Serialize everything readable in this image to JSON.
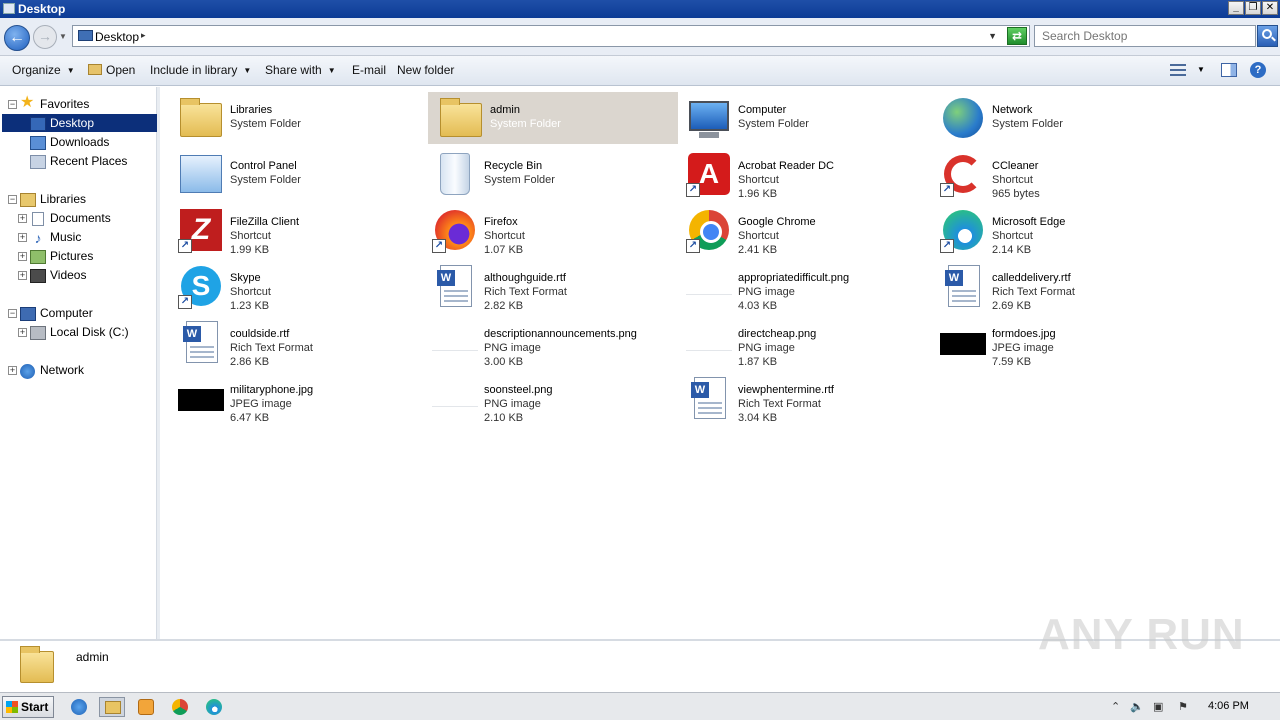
{
  "window": {
    "title": "Desktop"
  },
  "address": {
    "path": "Desktop",
    "search_placeholder": "Search Desktop"
  },
  "toolbar": {
    "organize": "Organize",
    "open": "Open",
    "include": "Include in library",
    "share": "Share with",
    "email": "E-mail",
    "newfolder": "New folder"
  },
  "nav": {
    "favorites": "Favorites",
    "desktop": "Desktop",
    "downloads": "Downloads",
    "recent": "Recent Places",
    "libraries": "Libraries",
    "documents": "Documents",
    "music": "Music",
    "pictures": "Pictures",
    "videos": "Videos",
    "computer": "Computer",
    "localdisk": "Local Disk (C:)",
    "network": "Network"
  },
  "items": [
    {
      "name": "Libraries",
      "type": "System Folder",
      "size": "",
      "icon": "libraries-folder-icon"
    },
    {
      "name": "admin",
      "type": "System Folder",
      "size": "",
      "icon": "user-folder-icon"
    },
    {
      "name": "Computer",
      "type": "System Folder",
      "size": "",
      "icon": "computer-icon"
    },
    {
      "name": "Network",
      "type": "System Folder",
      "size": "",
      "icon": "network-icon"
    },
    {
      "name": "Control Panel",
      "type": "System Folder",
      "size": "",
      "icon": "control-panel-icon"
    },
    {
      "name": "Recycle Bin",
      "type": "System Folder",
      "size": "",
      "icon": "recycle-bin-icon"
    },
    {
      "name": "Acrobat Reader DC",
      "type": "Shortcut",
      "size": "1.96 KB",
      "icon": "acrobat-icon"
    },
    {
      "name": "CCleaner",
      "type": "Shortcut",
      "size": "965 bytes",
      "icon": "ccleaner-icon"
    },
    {
      "name": "FileZilla Client",
      "type": "Shortcut",
      "size": "1.99 KB",
      "icon": "filezilla-icon"
    },
    {
      "name": "Firefox",
      "type": "Shortcut",
      "size": "1.07 KB",
      "icon": "firefox-icon"
    },
    {
      "name": "Google Chrome",
      "type": "Shortcut",
      "size": "2.41 KB",
      "icon": "chrome-icon"
    },
    {
      "name": "Microsoft Edge",
      "type": "Shortcut",
      "size": "2.14 KB",
      "icon": "edge-icon"
    },
    {
      "name": "Skype",
      "type": "Shortcut",
      "size": "1.23 KB",
      "icon": "skype-icon"
    },
    {
      "name": "althoughguide.rtf",
      "type": "Rich Text Format",
      "size": "2.82 KB",
      "icon": "wordpad-document-icon"
    },
    {
      "name": "appropriatedifficult.png",
      "type": "PNG image",
      "size": "4.03 KB",
      "icon": "png-thumbnail-icon"
    },
    {
      "name": "calleddelivery.rtf",
      "type": "Rich Text Format",
      "size": "2.69 KB",
      "icon": "wordpad-document-icon"
    },
    {
      "name": "couldside.rtf",
      "type": "Rich Text Format",
      "size": "2.86 KB",
      "icon": "wordpad-document-icon"
    },
    {
      "name": "descriptionannouncements.png",
      "type": "PNG image",
      "size": "3.00 KB",
      "icon": "png-thumbnail-icon"
    },
    {
      "name": "directcheap.png",
      "type": "PNG image",
      "size": "1.87 KB",
      "icon": "png-thumbnail-icon"
    },
    {
      "name": "formdoes.jpg",
      "type": "JPEG image",
      "size": "7.59 KB",
      "icon": "jpg-thumbnail-icon"
    },
    {
      "name": "militaryphone.jpg",
      "type": "JPEG image",
      "size": "6.47 KB",
      "icon": "jpg-thumbnail-icon"
    },
    {
      "name": "soonsteel.png",
      "type": "PNG image",
      "size": "2.10 KB",
      "icon": "png-thumbnail-icon"
    },
    {
      "name": "viewphentermine.rtf",
      "type": "Rich Text Format",
      "size": "3.04 KB",
      "icon": "wordpad-document-icon"
    }
  ],
  "details": {
    "name": "admin"
  },
  "taskbar": {
    "start": "Start",
    "clock": "4:06 PM"
  },
  "watermark": "ANY RUN",
  "colors": {
    "selection": "#dbd6cf",
    "nav_selected": "#0c2f7a",
    "titlebar": "#1f4fa8"
  }
}
